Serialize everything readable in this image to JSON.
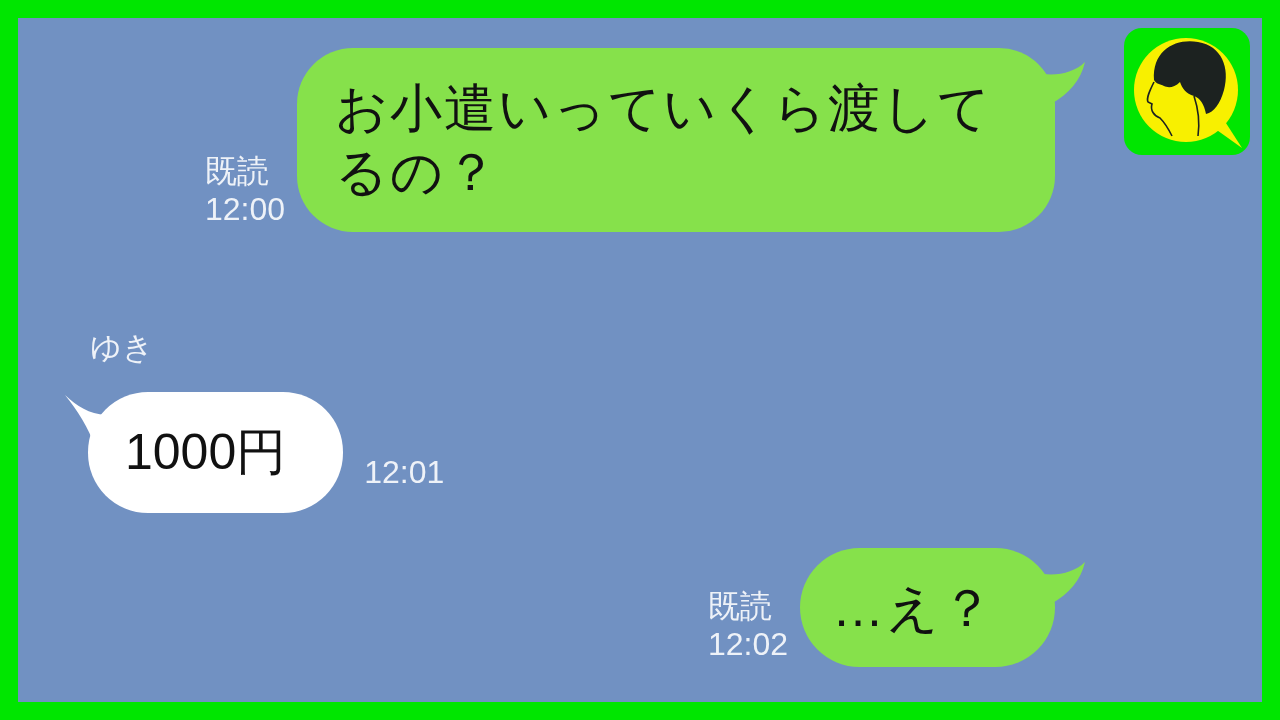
{
  "chat": {
    "messages": [
      {
        "kind": "sent",
        "text": "お小遣いっていくら渡してるの？",
        "read_label": "既読",
        "time": "12:00"
      },
      {
        "kind": "received",
        "sender": "ゆき",
        "text": "1000円",
        "time": "12:01"
      },
      {
        "kind": "sent",
        "text": "…え？",
        "read_label": "既読",
        "time": "12:02"
      }
    ]
  }
}
